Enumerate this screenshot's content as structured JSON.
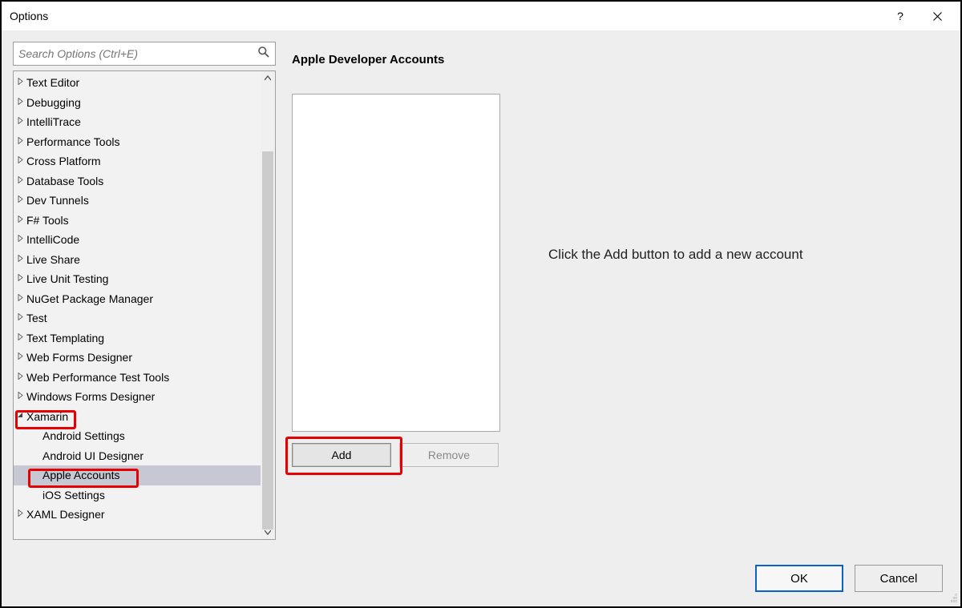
{
  "window": {
    "title": "Options"
  },
  "search": {
    "placeholder": "Search Options (Ctrl+E)"
  },
  "tree": {
    "items": [
      {
        "label": "Text Editor",
        "expanded": false,
        "child": false
      },
      {
        "label": "Debugging",
        "expanded": false,
        "child": false
      },
      {
        "label": "IntelliTrace",
        "expanded": false,
        "child": false
      },
      {
        "label": "Performance Tools",
        "expanded": false,
        "child": false
      },
      {
        "label": "Cross Platform",
        "expanded": false,
        "child": false
      },
      {
        "label": "Database Tools",
        "expanded": false,
        "child": false
      },
      {
        "label": "Dev Tunnels",
        "expanded": false,
        "child": false
      },
      {
        "label": "F# Tools",
        "expanded": false,
        "child": false
      },
      {
        "label": "IntelliCode",
        "expanded": false,
        "child": false
      },
      {
        "label": "Live Share",
        "expanded": false,
        "child": false
      },
      {
        "label": "Live Unit Testing",
        "expanded": false,
        "child": false
      },
      {
        "label": "NuGet Package Manager",
        "expanded": false,
        "child": false
      },
      {
        "label": "Test",
        "expanded": false,
        "child": false
      },
      {
        "label": "Text Templating",
        "expanded": false,
        "child": false
      },
      {
        "label": "Web Forms Designer",
        "expanded": false,
        "child": false
      },
      {
        "label": "Web Performance Test Tools",
        "expanded": false,
        "child": false
      },
      {
        "label": "Windows Forms Designer",
        "expanded": false,
        "child": false
      },
      {
        "label": "Xamarin",
        "expanded": true,
        "child": false,
        "highlight": true
      },
      {
        "label": "Android Settings",
        "expanded": false,
        "child": true
      },
      {
        "label": "Android UI Designer",
        "expanded": false,
        "child": true
      },
      {
        "label": "Apple Accounts",
        "expanded": false,
        "child": true,
        "selected": true,
        "highlight": true
      },
      {
        "label": "iOS Settings",
        "expanded": false,
        "child": true
      },
      {
        "label": "XAML Designer",
        "expanded": false,
        "child": false
      }
    ]
  },
  "panel": {
    "header": "Apple Developer Accounts",
    "hint": "Click the Add button to add a new account",
    "add_label": "Add",
    "remove_label": "Remove"
  },
  "dialog": {
    "ok": "OK",
    "cancel": "Cancel"
  },
  "colors": {
    "highlight": "#e60000",
    "selection": "#c8c8d4",
    "primary_border": "#0b61c4"
  }
}
